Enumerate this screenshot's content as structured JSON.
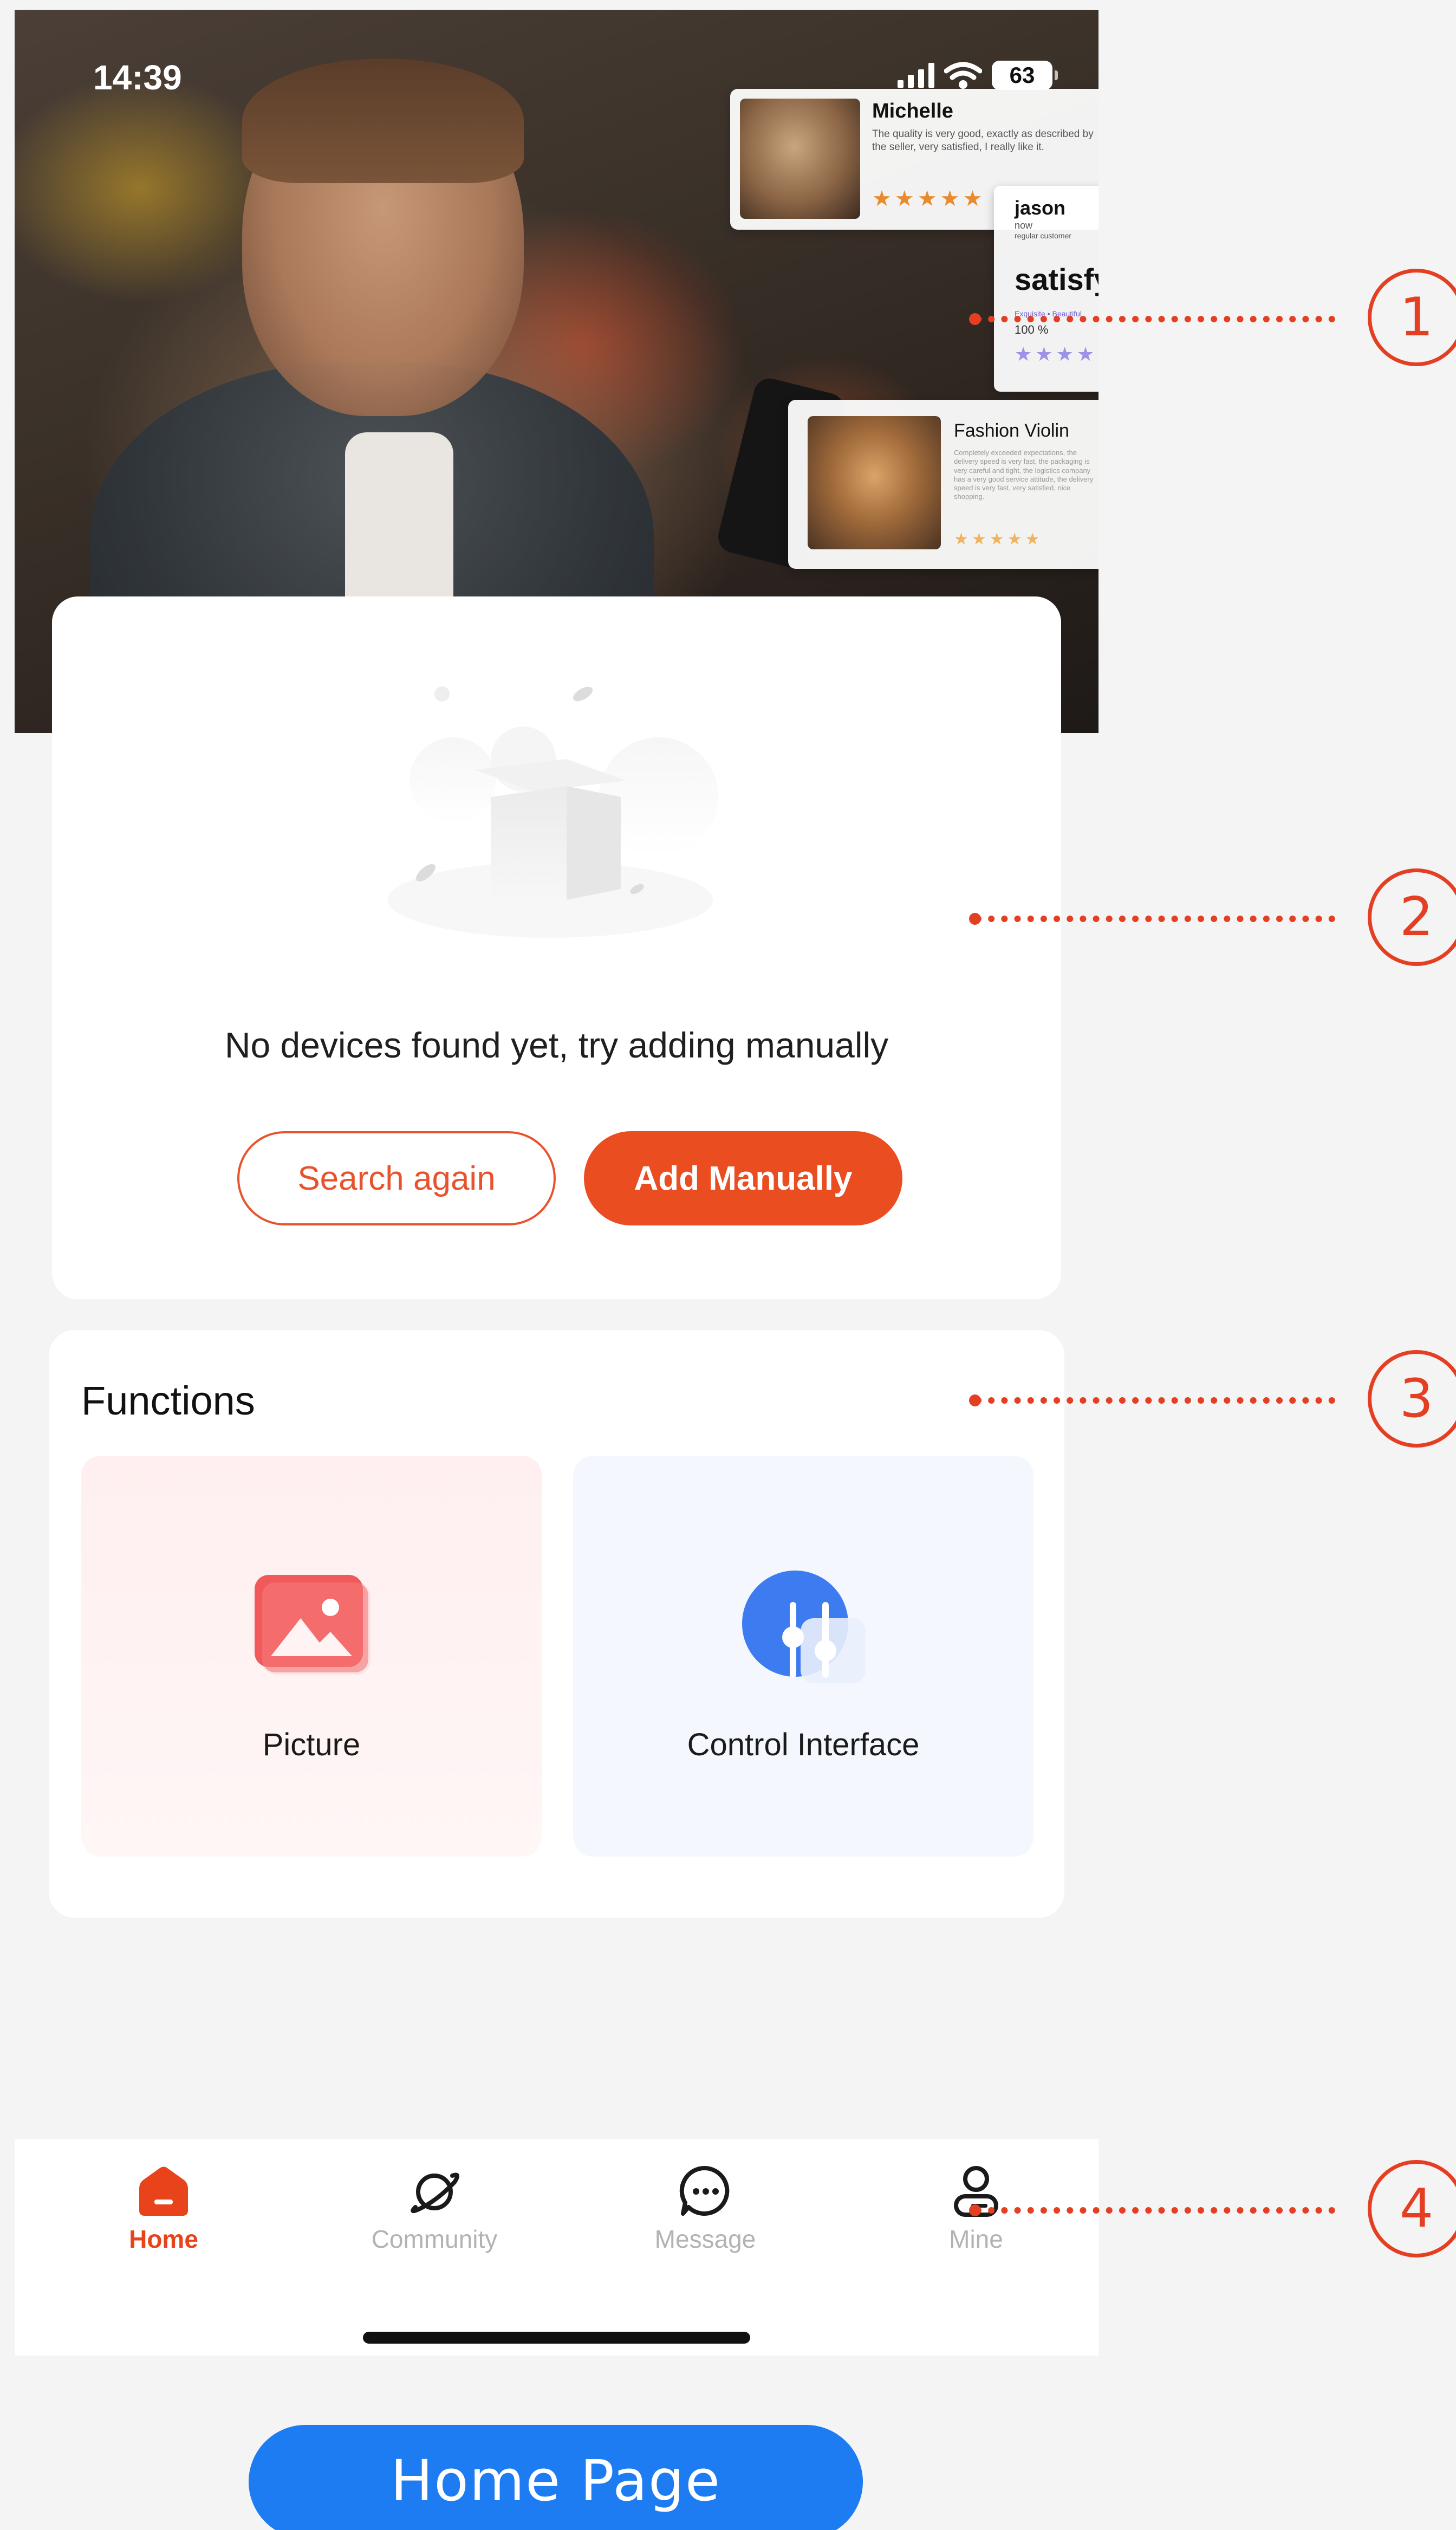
{
  "status_bar": {
    "time": "14:39",
    "battery": "63"
  },
  "reviews": [
    {
      "name": "Michelle",
      "text": "The quality is very good, exactly as described by the seller, very satisfied, I really like it.",
      "stars": "★★★★★"
    },
    {
      "name": "jason",
      "sub1": "now",
      "sub2": "regular customer",
      "headline": "satisfy",
      "tag": "Exquisite • Beautiful",
      "percent": "100 %",
      "stars": "★★★★★"
    },
    {
      "name": "Fashion Violin",
      "text": "Completely exceeded expectations, the delivery speed is very fast, the packaging is very careful and tight, the logistics company has a very good service attitude, the delivery speed is very fast, very satisfied, nice shopping.",
      "stars": "★★★★★"
    }
  ],
  "empty_state": {
    "message": "No devices found yet, try adding manually",
    "search_again": "Search again",
    "add_manually": "Add Manually"
  },
  "functions": {
    "title": "Functions",
    "items": [
      {
        "label": "Picture",
        "icon": "picture-icon",
        "color": "#f05a5a"
      },
      {
        "label": "Control Interface",
        "icon": "control-sliders-icon",
        "color": "#3d7cf0"
      }
    ]
  },
  "tab_bar": {
    "tabs": [
      {
        "label": "Home",
        "icon": "home-icon",
        "active": true
      },
      {
        "label": "Community",
        "icon": "planet-icon",
        "active": false
      },
      {
        "label": "Message",
        "icon": "chat-bubble-icon",
        "active": false
      },
      {
        "label": "Mine",
        "icon": "user-icon",
        "active": false
      }
    ]
  },
  "annotations": [
    "1",
    "2",
    "3",
    "4"
  ],
  "page_label": "Home Page",
  "colors": {
    "accent": "#ea4d20",
    "annotation": "#e43f23",
    "pill": "#1d7cf2"
  }
}
